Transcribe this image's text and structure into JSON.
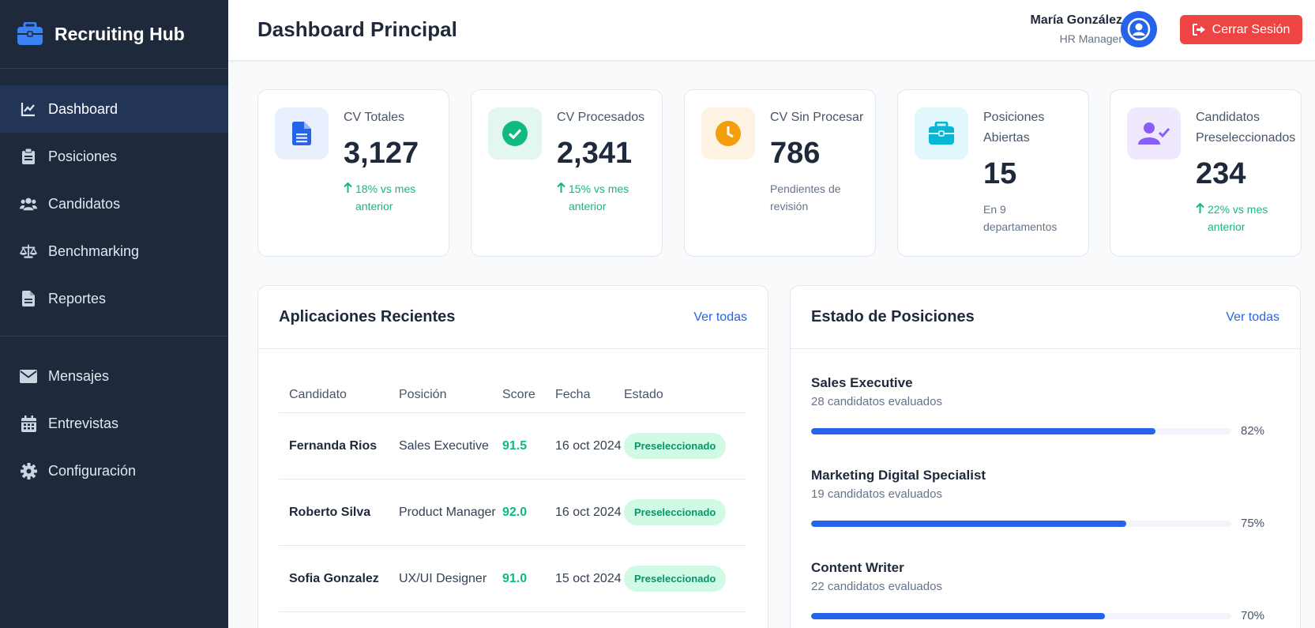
{
  "app": {
    "brand": "Recruiting Hub"
  },
  "sidebar": {
    "items": [
      {
        "label": "Dashboard",
        "icon": "chart-line-icon",
        "active": true
      },
      {
        "label": "Posiciones",
        "icon": "clipboard-icon"
      },
      {
        "label": "Candidatos",
        "icon": "users-icon"
      },
      {
        "label": "Benchmarking",
        "icon": "scale-icon"
      },
      {
        "label": "Reportes",
        "icon": "document-icon"
      },
      {
        "label": "Mensajes",
        "icon": "envelope-icon"
      },
      {
        "label": "Entrevistas",
        "icon": "calendar-icon"
      },
      {
        "label": "Configuración",
        "icon": "gear-icon"
      }
    ]
  },
  "header": {
    "title": "Dashboard Principal",
    "user_name": "María González",
    "user_role": "HR Manager",
    "logout_label": "Cerrar Sesión"
  },
  "stats": [
    {
      "label": "CV Totales",
      "value": "3,127",
      "note": "18% vs mes anterior",
      "trend": "up",
      "icon": "file-icon",
      "color": "#2563eb",
      "bg": "#e8effd"
    },
    {
      "label": "CV Procesados",
      "value": "2,341",
      "note": "15% vs mes anterior",
      "trend": "up",
      "icon": "check-circle-icon",
      "color": "#10b981",
      "bg": "#e3f7ef"
    },
    {
      "label": "CV Sin Procesar",
      "value": "786",
      "note": "Pendientes de revisión",
      "trend": "none",
      "icon": "clock-icon",
      "color": "#f59e0b",
      "bg": "#fef2e2"
    },
    {
      "label": "Posiciones Abiertas",
      "value": "15",
      "note": "En 9 departamentos",
      "trend": "none",
      "icon": "briefcase-icon",
      "color": "#06b6d4",
      "bg": "#e0f7fb"
    },
    {
      "label": "Candidatos Preseleccionados",
      "value": "234",
      "note": "22% vs mes anterior",
      "trend": "up",
      "icon": "user-check-icon",
      "color": "#8b5cf6",
      "bg": "#f0e9fe"
    }
  ],
  "applications": {
    "title": "Aplicaciones Recientes",
    "link": "Ver todas",
    "columns": [
      "Candidato",
      "Posición",
      "Score",
      "Fecha",
      "Estado"
    ],
    "rows": [
      {
        "candidate": "Fernanda Rios",
        "position": "Sales Executive",
        "score": "91.5",
        "date": "16 oct 2024",
        "status": "Preseleccionado"
      },
      {
        "candidate": "Roberto Silva",
        "position": "Product Manager",
        "score": "92.0",
        "date": "16 oct 2024",
        "status": "Preseleccionado"
      },
      {
        "candidate": "Sofia Gonzalez",
        "position": "UX/UI Designer",
        "score": "91.0",
        "date": "15 oct 2024",
        "status": "Preseleccionado"
      }
    ]
  },
  "positions": {
    "title": "Estado de Posiciones",
    "link": "Ver todas",
    "items": [
      {
        "name": "Sales Executive",
        "count": "28 candidatos evaluados",
        "percent": 82,
        "percent_label": "82%"
      },
      {
        "name": "Marketing Digital Specialist",
        "count": "19 candidatos evaluados",
        "percent": 75,
        "percent_label": "75%"
      },
      {
        "name": "Content Writer",
        "count": "22 candidatos evaluados",
        "percent": 70,
        "percent_label": "70%"
      }
    ]
  }
}
